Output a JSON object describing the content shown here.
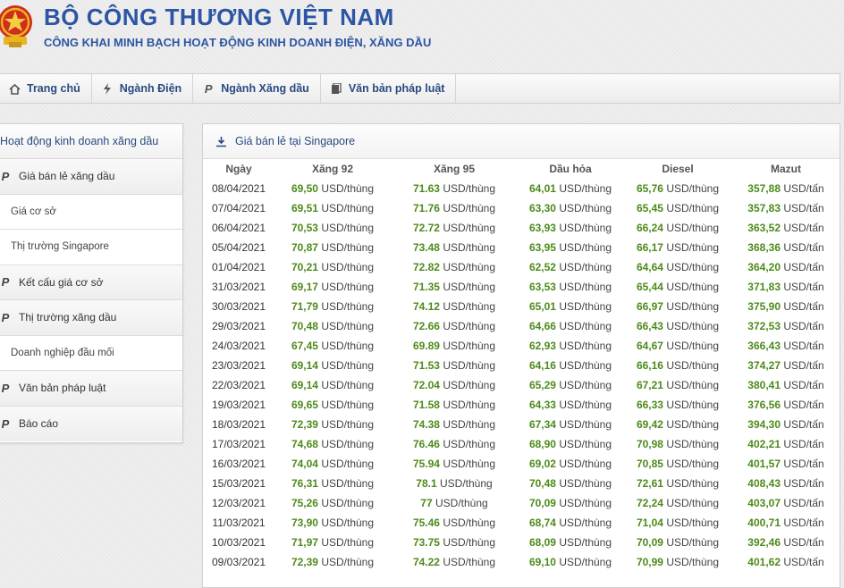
{
  "header": {
    "title": "BỘ CÔNG THƯƠNG VIỆT NAM",
    "subtitle": "CÔNG KHAI MINH BẠCH HOẠT ĐỘNG KINH DOANH ĐIỆN, XĂNG DẦU"
  },
  "nav": [
    {
      "label": "Trang chủ",
      "icon": "home-icon"
    },
    {
      "label": "Ngành Điện",
      "icon": "lightning-icon"
    },
    {
      "label": "Ngành Xăng dầu",
      "icon": "petrol-p-icon"
    },
    {
      "label": "Văn bản pháp luật",
      "icon": "document-icon"
    }
  ],
  "sidebar": {
    "heading": "Hoạt động kinh doanh xăng dầu",
    "items": [
      {
        "label": "Giá bán lẻ xăng dầu",
        "type": "group"
      },
      {
        "label": "Giá cơ sở",
        "type": "sub"
      },
      {
        "label": "Thị trường Singapore",
        "type": "sub"
      },
      {
        "label": "Kết cấu giá cơ sở",
        "type": "group"
      },
      {
        "label": "Thị trường xăng dầu",
        "type": "group"
      },
      {
        "label": "Doanh nghiệp đầu mối",
        "type": "sub"
      },
      {
        "label": "Văn bản pháp luật",
        "type": "group"
      },
      {
        "label": "Báo cáo",
        "type": "group"
      }
    ]
  },
  "panel": {
    "title": "Giá bán lẻ tại Singapore",
    "columns": [
      "Ngày",
      "Xăng 92",
      "Xăng 95",
      "Dầu hỏa",
      "Diesel",
      "Mazut"
    ],
    "units": [
      "USD/thùng",
      "USD/thùng",
      "USD/thùng",
      "USD/thùng",
      "USD/tấn"
    ],
    "rows": [
      [
        "08/04/2021",
        "69,50",
        "71.63",
        "64,01",
        "65,76",
        "357,88"
      ],
      [
        "07/04/2021",
        "69,51",
        "71.76",
        "63,30",
        "65,45",
        "357,83"
      ],
      [
        "06/04/2021",
        "70,53",
        "72.72",
        "63,93",
        "66,24",
        "363,52"
      ],
      [
        "05/04/2021",
        "70,87",
        "73.48",
        "63,95",
        "66,17",
        "368,36"
      ],
      [
        "01/04/2021",
        "70,21",
        "72.82",
        "62,52",
        "64,64",
        "364,20"
      ],
      [
        "31/03/2021",
        "69,17",
        "71.35",
        "63,53",
        "65,44",
        "371,83"
      ],
      [
        "30/03/2021",
        "71,79",
        "74.12",
        "65,01",
        "66,97",
        "375,90"
      ],
      [
        "29/03/2021",
        "70,48",
        "72.66",
        "64,66",
        "66,43",
        "372,53"
      ],
      [
        "24/03/2021",
        "67,45",
        "69.89",
        "62,93",
        "64,67",
        "366,43"
      ],
      [
        "23/03/2021",
        "69,14",
        "71.53",
        "64,16",
        "66,16",
        "374,27"
      ],
      [
        "22/03/2021",
        "69,14",
        "72.04",
        "65,29",
        "67,21",
        "380,41"
      ],
      [
        "19/03/2021",
        "69,65",
        "71.58",
        "64,33",
        "66,33",
        "376,56"
      ],
      [
        "18/03/2021",
        "72,39",
        "74.38",
        "67,34",
        "69,42",
        "394,30"
      ],
      [
        "17/03/2021",
        "74,68",
        "76.46",
        "68,90",
        "70,98",
        "402,21"
      ],
      [
        "16/03/2021",
        "74,04",
        "75.94",
        "69,02",
        "70,85",
        "401,57"
      ],
      [
        "15/03/2021",
        "76,31",
        "78.1",
        "70,48",
        "72,61",
        "408,43"
      ],
      [
        "12/03/2021",
        "75,26",
        "77",
        "70,09",
        "72,24",
        "403,07"
      ],
      [
        "11/03/2021",
        "73,90",
        "75.46",
        "68,74",
        "71,04",
        "400,71"
      ],
      [
        "10/03/2021",
        "71,97",
        "73.75",
        "68,09",
        "70,09",
        "392,46"
      ],
      [
        "09/03/2021",
        "72,39",
        "74.22",
        "69,10",
        "70,99",
        "401,62"
      ]
    ]
  }
}
